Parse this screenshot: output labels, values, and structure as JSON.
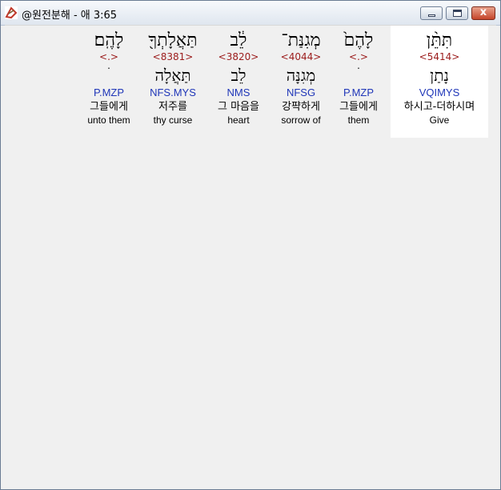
{
  "window": {
    "title": "@원전분해 - 애 3:65",
    "min_label": "",
    "max_label": "",
    "close_label": "x"
  },
  "words": [
    {
      "id": "give",
      "hebrew": "תִּתֵּ֨ן",
      "strong": "<5414>",
      "lemma": "נָתַן",
      "morph": "VQIMYS",
      "korean": "하시고-더하시며",
      "english": "Give",
      "active": true
    },
    {
      "id": "them1",
      "hebrew": "לָהֶם֙",
      "strong": "<.>",
      "lemma": "ׄ",
      "morph": "P.MZP",
      "korean": "그들에게",
      "english": "them",
      "active": false
    },
    {
      "id": "sorrow",
      "hebrew": "מְגִנַּת־",
      "strong": "<4044>",
      "lemma": "מְגִנָּה",
      "morph": "NFSG",
      "korean": "강퍅하게",
      "english": "sorrow of",
      "active": false
    },
    {
      "id": "heart",
      "hebrew": "לֵ֔ב",
      "strong": "<3820>",
      "lemma": "לֵב",
      "morph": "NMS",
      "korean": "그 마음을",
      "english": "heart",
      "active": false
    },
    {
      "id": "curse",
      "hebrew": "תַּאֲלָתְךָ֖",
      "strong": "<8381>",
      "lemma": "תַּאֲלָה",
      "morph": "NFS.MYS",
      "korean": "저주를",
      "english": "thy curse",
      "active": false
    },
    {
      "id": "them2",
      "hebrew": "לָהֶֽם׃",
      "strong": "<.>",
      "lemma": "ׄ",
      "morph": "P.MZP",
      "korean": "그들에게",
      "english": "unto them",
      "active": false
    }
  ]
}
